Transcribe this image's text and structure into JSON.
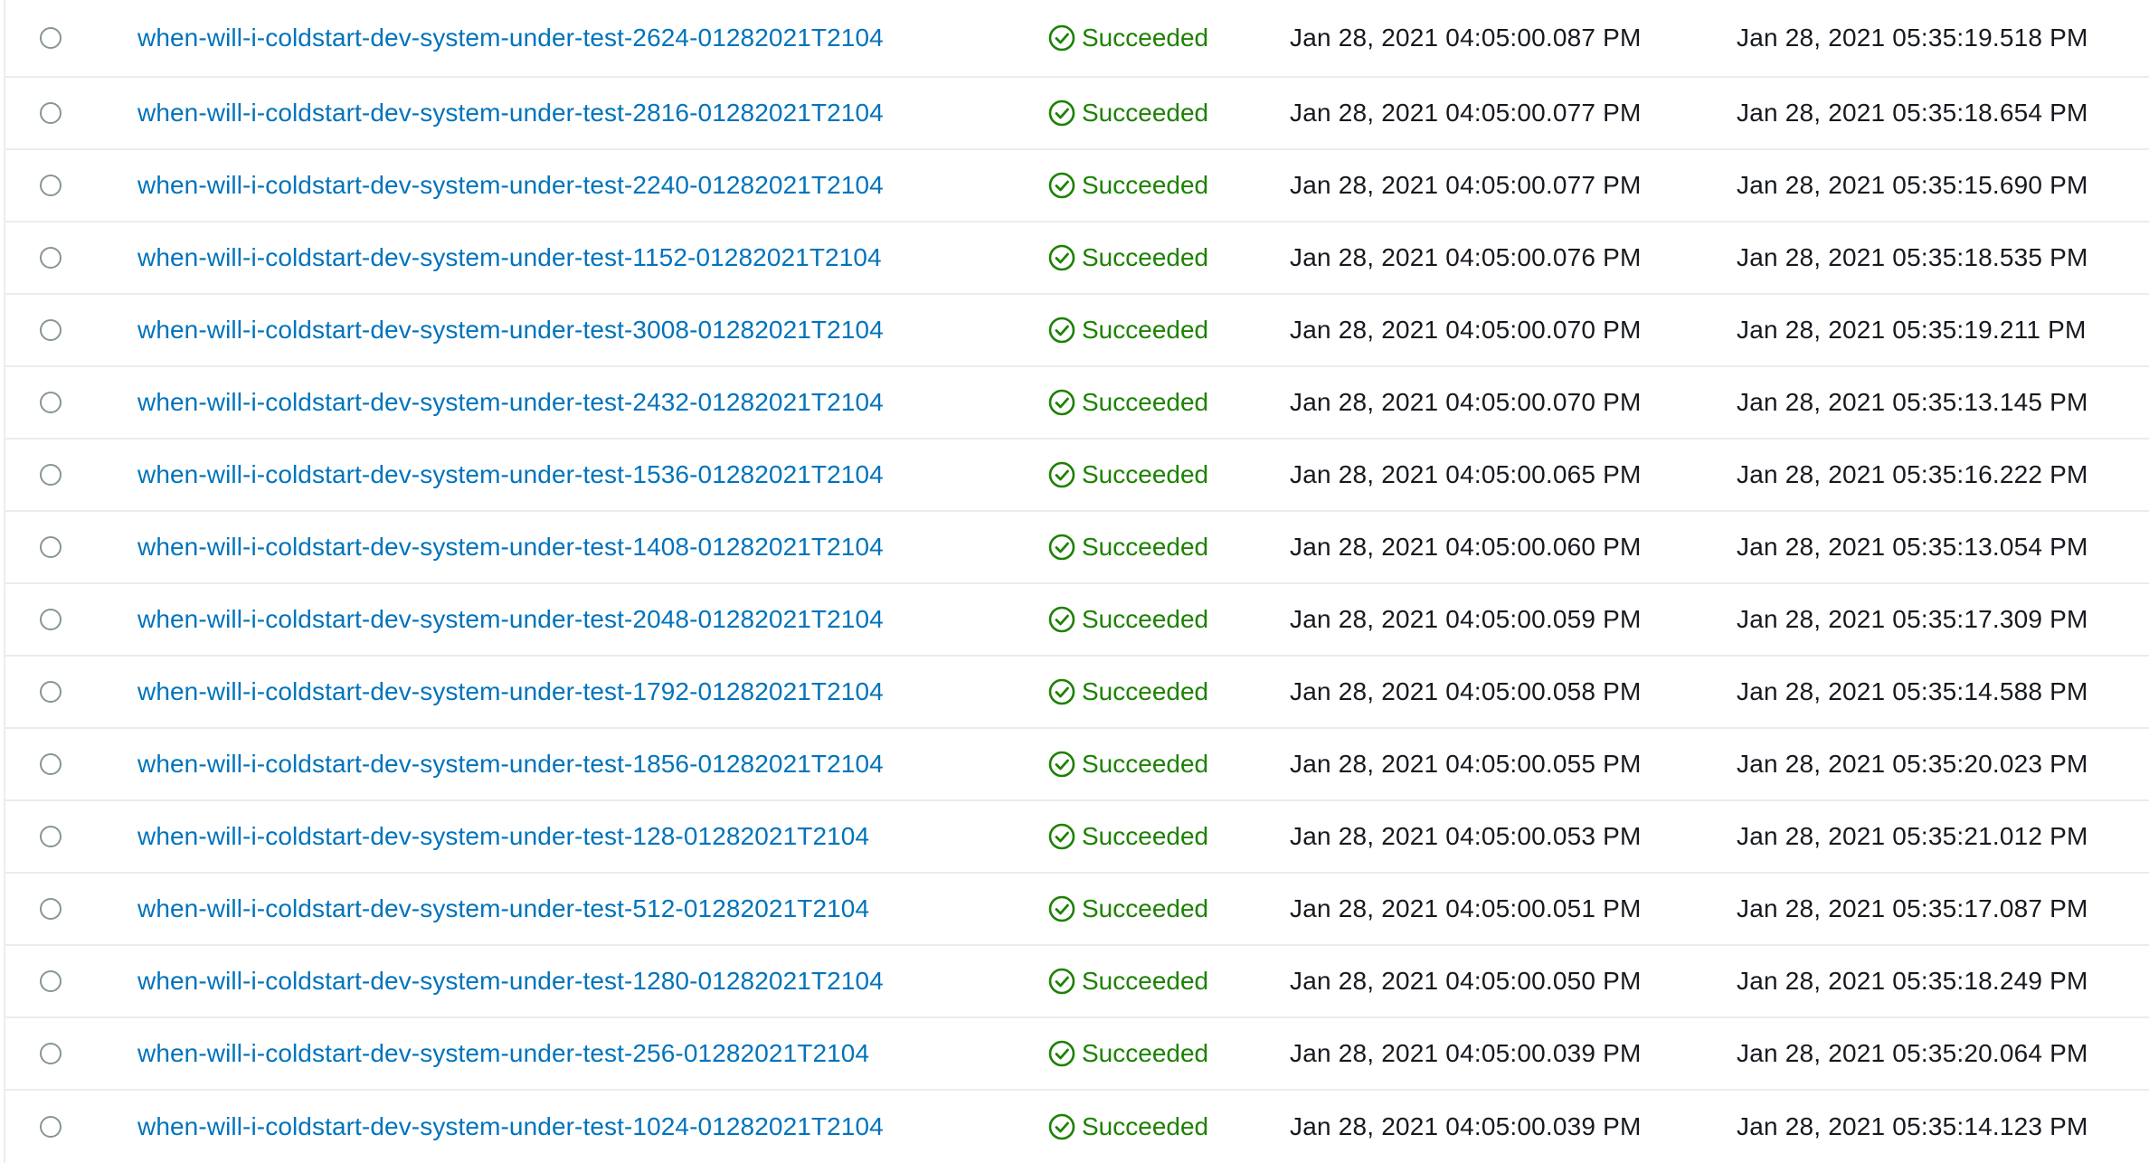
{
  "executions": [
    {
      "name": "when-will-i-coldstart-dev-system-under-test-2624-01282021T2104",
      "status": "Succeeded",
      "started": "Jan 28, 2021 04:05:00.087 PM",
      "ended": "Jan 28, 2021 05:35:19.518 PM"
    },
    {
      "name": "when-will-i-coldstart-dev-system-under-test-2816-01282021T2104",
      "status": "Succeeded",
      "started": "Jan 28, 2021 04:05:00.077 PM",
      "ended": "Jan 28, 2021 05:35:18.654 PM"
    },
    {
      "name": "when-will-i-coldstart-dev-system-under-test-2240-01282021T2104",
      "status": "Succeeded",
      "started": "Jan 28, 2021 04:05:00.077 PM",
      "ended": "Jan 28, 2021 05:35:15.690 PM"
    },
    {
      "name": "when-will-i-coldstart-dev-system-under-test-1152-01282021T2104",
      "status": "Succeeded",
      "started": "Jan 28, 2021 04:05:00.076 PM",
      "ended": "Jan 28, 2021 05:35:18.535 PM"
    },
    {
      "name": "when-will-i-coldstart-dev-system-under-test-3008-01282021T2104",
      "status": "Succeeded",
      "started": "Jan 28, 2021 04:05:00.070 PM",
      "ended": "Jan 28, 2021 05:35:19.211 PM"
    },
    {
      "name": "when-will-i-coldstart-dev-system-under-test-2432-01282021T2104",
      "status": "Succeeded",
      "started": "Jan 28, 2021 04:05:00.070 PM",
      "ended": "Jan 28, 2021 05:35:13.145 PM"
    },
    {
      "name": "when-will-i-coldstart-dev-system-under-test-1536-01282021T2104",
      "status": "Succeeded",
      "started": "Jan 28, 2021 04:05:00.065 PM",
      "ended": "Jan 28, 2021 05:35:16.222 PM"
    },
    {
      "name": "when-will-i-coldstart-dev-system-under-test-1408-01282021T2104",
      "status": "Succeeded",
      "started": "Jan 28, 2021 04:05:00.060 PM",
      "ended": "Jan 28, 2021 05:35:13.054 PM"
    },
    {
      "name": "when-will-i-coldstart-dev-system-under-test-2048-01282021T2104",
      "status": "Succeeded",
      "started": "Jan 28, 2021 04:05:00.059 PM",
      "ended": "Jan 28, 2021 05:35:17.309 PM"
    },
    {
      "name": "when-will-i-coldstart-dev-system-under-test-1792-01282021T2104",
      "status": "Succeeded",
      "started": "Jan 28, 2021 04:05:00.058 PM",
      "ended": "Jan 28, 2021 05:35:14.588 PM"
    },
    {
      "name": "when-will-i-coldstart-dev-system-under-test-1856-01282021T2104",
      "status": "Succeeded",
      "started": "Jan 28, 2021 04:05:00.055 PM",
      "ended": "Jan 28, 2021 05:35:20.023 PM"
    },
    {
      "name": "when-will-i-coldstart-dev-system-under-test-128-01282021T2104",
      "status": "Succeeded",
      "started": "Jan 28, 2021 04:05:00.053 PM",
      "ended": "Jan 28, 2021 05:35:21.012 PM"
    },
    {
      "name": "when-will-i-coldstart-dev-system-under-test-512-01282021T2104",
      "status": "Succeeded",
      "started": "Jan 28, 2021 04:05:00.051 PM",
      "ended": "Jan 28, 2021 05:35:17.087 PM"
    },
    {
      "name": "when-will-i-coldstart-dev-system-under-test-1280-01282021T2104",
      "status": "Succeeded",
      "started": "Jan 28, 2021 04:05:00.050 PM",
      "ended": "Jan 28, 2021 05:35:18.249 PM"
    },
    {
      "name": "when-will-i-coldstart-dev-system-under-test-256-01282021T2104",
      "status": "Succeeded",
      "started": "Jan 28, 2021 04:05:00.039 PM",
      "ended": "Jan 28, 2021 05:35:20.064 PM"
    },
    {
      "name": "when-will-i-coldstart-dev-system-under-test-1024-01282021T2104",
      "status": "Succeeded",
      "started": "Jan 28, 2021 04:05:00.039 PM",
      "ended": "Jan 28, 2021 05:35:14.123 PM"
    }
  ],
  "icons": {
    "status": "check-circle-icon"
  },
  "colors": {
    "link": "#0073bb",
    "success": "#1d8102",
    "text": "#16191f",
    "divider": "#eaeded",
    "radio_border": "#879596"
  }
}
